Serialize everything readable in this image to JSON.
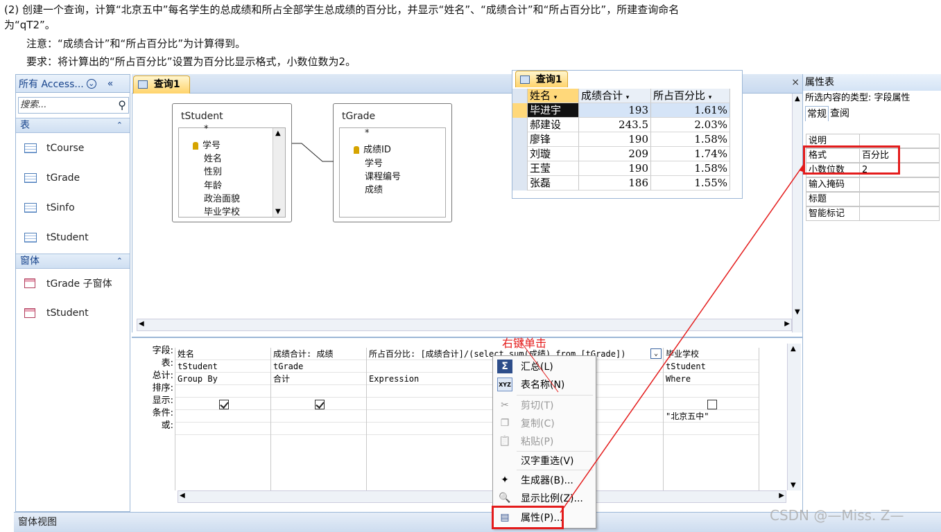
{
  "instructions": {
    "line1": "(2) 创建一个查询，计算“北京五中”每名学生的总成绩和所占全部学生总成绩的百分比，并显示“姓名”、“成绩合计”和“所占百分比”，所建查询命名",
    "line2": "为“qT2”。",
    "line3": "注意：“成绩合计”和“所占百分比”为计算得到。",
    "line4": "要求：将计算出的“所占百分比”设置为百分比显示格式，小数位数为2。"
  },
  "nav": {
    "header": "所有 Access...",
    "search_placeholder": "搜索...",
    "group_tables": "表",
    "tables": [
      "tCourse",
      "tGrade",
      "tSinfo",
      "tStudent"
    ],
    "group_forms": "窗体",
    "forms": [
      "tGrade 子窗体",
      "tStudent"
    ]
  },
  "tab": {
    "label": "查询1"
  },
  "tables": {
    "student": {
      "title": "tStudent",
      "fields": [
        "*",
        "学号",
        "姓名",
        "性别",
        "年龄",
        "政治面貌",
        "毕业学校"
      ]
    },
    "grade": {
      "title": "tGrade",
      "fields": [
        "*",
        "成绩ID",
        "学号",
        "课程编号",
        "成绩"
      ]
    }
  },
  "grid": {
    "labels": [
      "字段:",
      "表:",
      "总计:",
      "排序:",
      "显示:",
      "条件:",
      "或:"
    ],
    "columns": [
      {
        "field": "姓名",
        "table": "tStudent",
        "total": "Group By",
        "show": true,
        "criteria": ""
      },
      {
        "field": "成绩合计: 成绩",
        "table": "tGrade",
        "total": "合计",
        "show": true,
        "criteria": ""
      },
      {
        "field": "所占百分比: [成绩合计]/(select sum(成绩) from [tGrade])",
        "table": "",
        "total": "Expression",
        "show": null,
        "criteria": ""
      },
      {
        "field": "毕业学校",
        "table": "tStudent",
        "total": "Where",
        "show": false,
        "criteria": "\"北京五中\""
      }
    ]
  },
  "status_bar": "窗体视图",
  "props": {
    "header": "属性表",
    "selection_type": "所选内容的类型: 字段属性",
    "tabs": [
      "常规",
      "查阅"
    ],
    "rows": [
      {
        "key": "说明",
        "value": ""
      },
      {
        "key": "格式",
        "value": "百分比"
      },
      {
        "key": "小数位数",
        "value": "2"
      },
      {
        "key": "输入掩码",
        "value": ""
      },
      {
        "key": "标题",
        "value": ""
      },
      {
        "key": "智能标记",
        "value": ""
      }
    ]
  },
  "sheet": {
    "tab": "查询1",
    "headers": [
      "姓名",
      "成绩合计",
      "所占百分比"
    ],
    "rows": [
      [
        "毕进宇",
        "193",
        "1.61%"
      ],
      [
        "郝建设",
        "243.5",
        "2.03%"
      ],
      [
        "廖锋",
        "190",
        "1.58%"
      ],
      [
        "刘璇",
        "209",
        "1.74%"
      ],
      [
        "王莹",
        "190",
        "1.58%"
      ],
      [
        "张磊",
        "186",
        "1.55%"
      ]
    ]
  },
  "context_menu": {
    "items": [
      {
        "label": "汇总(L)",
        "icon": "sigma-icon",
        "glyph": "Σ",
        "enabled": true
      },
      {
        "label": "表名称(N)",
        "icon": "table-names-icon",
        "glyph": "XYZ",
        "enabled": true
      },
      {
        "label": "剪切(T)",
        "icon": "scissors-icon",
        "glyph": "✂",
        "enabled": false
      },
      {
        "label": "复制(C)",
        "icon": "copy-icon",
        "glyph": "❐",
        "enabled": false
      },
      {
        "label": "粘贴(P)",
        "icon": "paste-icon",
        "glyph": "📋",
        "enabled": false
      },
      {
        "label": "汉字重选(V)",
        "icon": "",
        "glyph": "",
        "enabled": true
      },
      {
        "label": "生成器(B)...",
        "icon": "builder-wand-icon",
        "glyph": "✦",
        "enabled": true
      },
      {
        "label": "显示比例(Z)...",
        "icon": "zoom-icon",
        "glyph": "🔍",
        "enabled": true
      },
      {
        "label": "属性(P)...",
        "icon": "properties-icon",
        "glyph": "▤",
        "enabled": true
      }
    ]
  },
  "annotation": {
    "right_click": "右键单击"
  },
  "watermark": "CSDN @—Miss. Z—",
  "colors": {
    "highlight": "#e41b1b",
    "office_blue": "#9bb6d6",
    "tab_gold": "#ffd36a"
  }
}
